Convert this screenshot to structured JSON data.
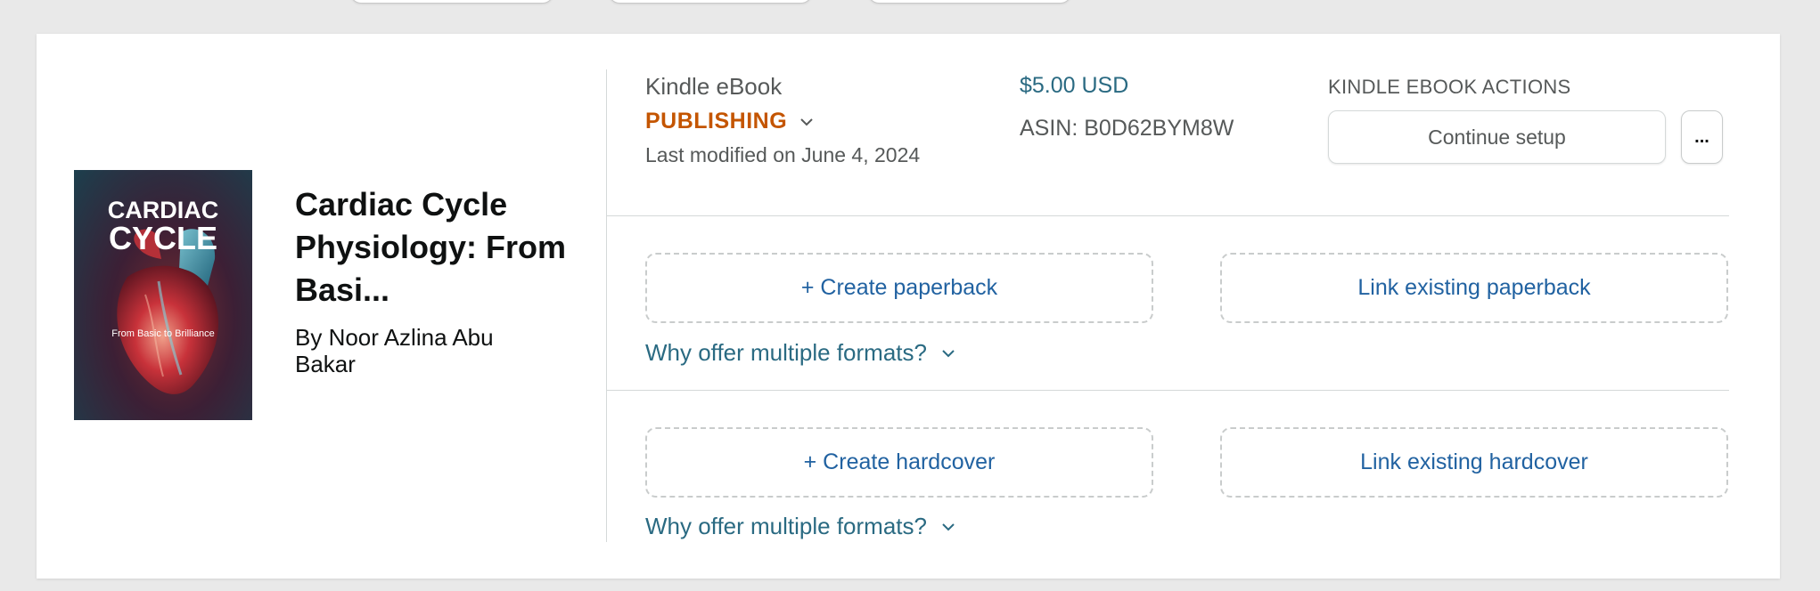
{
  "book": {
    "title": "Cardiac Cycle Physiology: From Basi...",
    "author": "By Noor Azlina Abu Bakar",
    "cover": {
      "line1": "CARDIAC",
      "line2": "CYCLE",
      "subtitle": "From Basic to Brilliance"
    }
  },
  "ebook": {
    "format": "Kindle eBook",
    "status": "PUBLISHING",
    "last_modified": "Last modified on June 4, 2024",
    "price": "$5.00 USD",
    "asin": "ASIN: B0D62BYM8W",
    "actions_label": "KINDLE EBOOK ACTIONS",
    "continue_label": "Continue setup",
    "more_label": "..."
  },
  "paperback": {
    "create_label": "+ Create paperback",
    "link_label": "Link existing paperback",
    "why_label": "Why offer multiple formats?"
  },
  "hardcover": {
    "create_label": "+ Create hardcover",
    "link_label": "Link existing hardcover",
    "why_label": "Why offer multiple formats?"
  },
  "colors": {
    "status": "#c45500",
    "link": "#2162a1",
    "teal_link": "#2a6a82",
    "muted": "#565959"
  }
}
